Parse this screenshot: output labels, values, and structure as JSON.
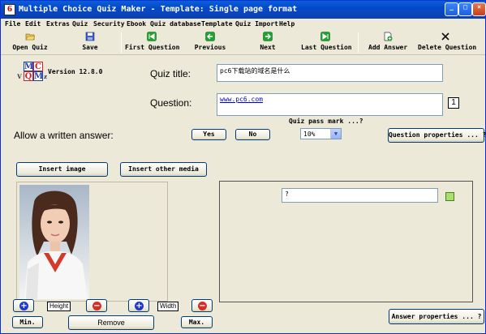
{
  "window": {
    "title": "Multiple Choice Quiz Maker - Template: Single page format",
    "controls": {
      "minimize": "_",
      "maximize": "□",
      "close": "×"
    }
  },
  "menu": [
    "File",
    "Edit",
    "Extras",
    "Quiz",
    "Security",
    "Ebook",
    "Quiz database",
    "Template",
    "Quiz Import",
    "Help"
  ],
  "toolbar": {
    "open_quiz": "Open Quiz",
    "save": "Save",
    "first_question": "First Question",
    "previous": "Previous",
    "next": "Next",
    "last_question": "Last Question",
    "add_answer": "Add Answer",
    "delete_question": "Delete Question"
  },
  "logo": {
    "letters": [
      "M",
      "C",
      "Q",
      "M"
    ],
    "small": [
      "V",
      "z"
    ]
  },
  "version": "Version 12.8.0",
  "quiz_title": {
    "label": "Quiz title:",
    "value": "pc6下载站的域名是什么"
  },
  "question": {
    "label": "Question:",
    "value": "www.pc6.com",
    "number": "1"
  },
  "pass_mark": {
    "label": "Quiz pass mark ...?",
    "value": "10%"
  },
  "written_answer": {
    "label": "Allow a written answer:",
    "yes": "Yes",
    "no": "No"
  },
  "buttons": {
    "question_properties": "Question properties ... ?",
    "insert_image": "Insert image",
    "insert_other_media": "Insert other media",
    "answer_properties": "Answer properties ... ?",
    "min": "Min.",
    "remove": "Remove",
    "max": "Max."
  },
  "answer": {
    "value": "?"
  },
  "image_controls": {
    "height": "Height",
    "width": "Width",
    "plus": "+",
    "minus": "−"
  },
  "colors": {
    "titlebar": "#0a4fd0",
    "face": "#ece9d8",
    "accent_green": "#aadf6b"
  },
  "icons": {
    "open_quiz": "folder-open-icon",
    "save": "floppy-disk-icon",
    "first_question": "first-arrow-icon",
    "previous": "left-arrow-icon",
    "next": "right-arrow-icon",
    "last_question": "last-arrow-icon",
    "add_answer": "add-document-icon",
    "delete_question": "delete-x-icon"
  }
}
